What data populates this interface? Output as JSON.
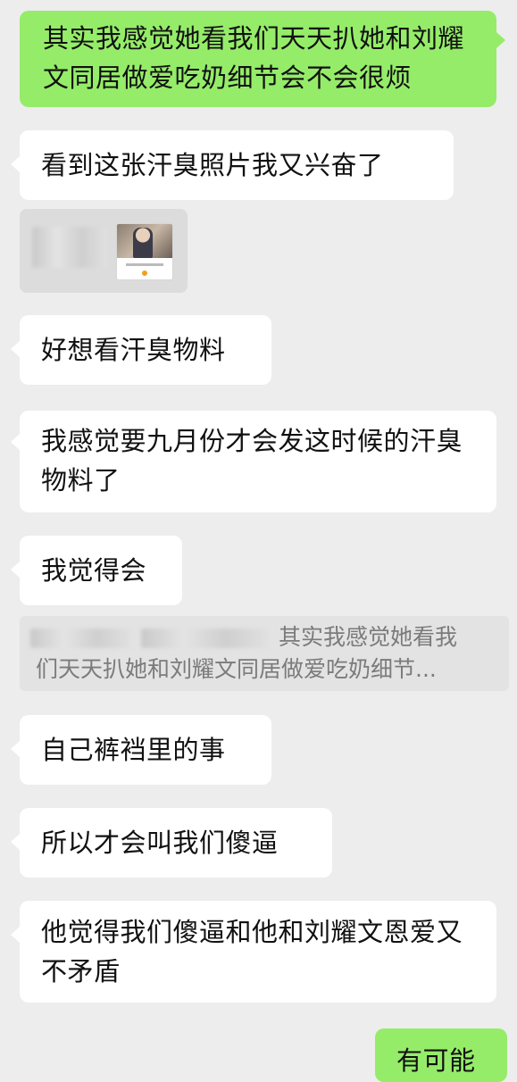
{
  "messages": {
    "m1": {
      "text": "其实我感觉她看我们天天扒她和刘耀文同居做爱吃奶细节会不会很烦"
    },
    "m2": {
      "text": "看到这张汗臭照片我又兴奋了"
    },
    "m3": {
      "text": "好想看汗臭物料"
    },
    "m4": {
      "text": "我感觉要九月份才会发这时候的汗臭物料了"
    },
    "m5": {
      "text": "我觉得会"
    },
    "m6": {
      "text": "自己裤裆里的事"
    },
    "m7": {
      "text": "所以才会叫我们傻逼"
    },
    "m8": {
      "text": "他觉得我们傻逼和他和刘耀文恩爱又不矛盾"
    },
    "m9": {
      "text": "有可能"
    }
  },
  "quote": {
    "line1": "其实我感觉她看我",
    "line2": "们天天扒她和刘耀文同居做爱吃奶细节..."
  },
  "colors": {
    "background": "#ededed",
    "incoming_bubble": "#ffffff",
    "outgoing_bubble": "#95ec69",
    "quote_background": "#e3e3e3",
    "quote_text": "#7b7b7b"
  }
}
